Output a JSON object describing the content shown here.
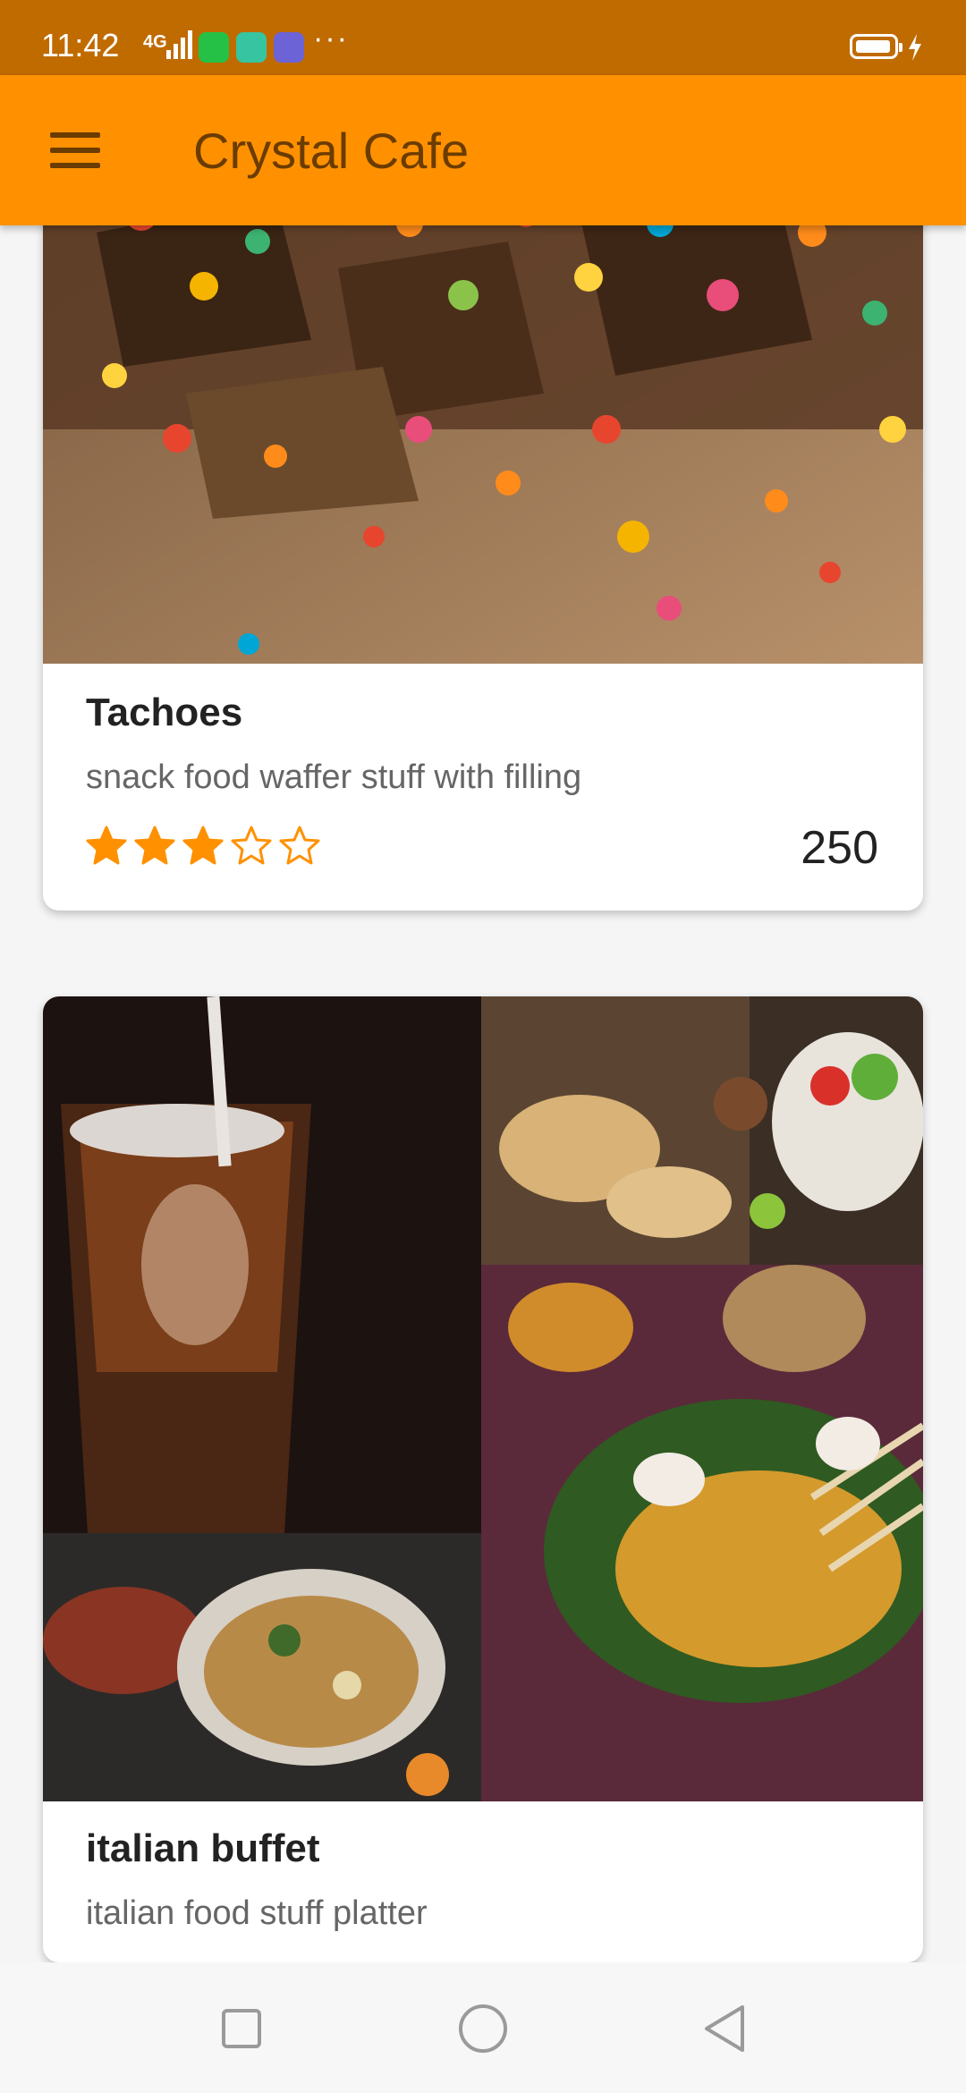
{
  "status_bar": {
    "time": "11:42",
    "network": "4G",
    "more": "···",
    "icons": [
      "signal-icon",
      "whatsapp-icon",
      "app-icon",
      "app-icon",
      "battery-icon",
      "charging-icon"
    ],
    "colors": {
      "bg": "#c06b00"
    }
  },
  "app_bar": {
    "title": "Crystal Cafe",
    "menu_icon": "hamburger-menu-icon",
    "colors": {
      "bg": "#ff9100",
      "text": "#6b3c00"
    }
  },
  "items": [
    {
      "name": "Tachoes",
      "description": "snack food waffer stuff with filling",
      "rating": 3,
      "rating_max": 5,
      "price": "250",
      "image": "colorful-cereal-snack-photo"
    },
    {
      "name": "italian buffet",
      "description": "italian food stuff platter",
      "image": "food-collage-photo"
    }
  ],
  "nav_bar": {
    "buttons": [
      "recent-apps-icon",
      "home-icon",
      "back-icon"
    ]
  }
}
